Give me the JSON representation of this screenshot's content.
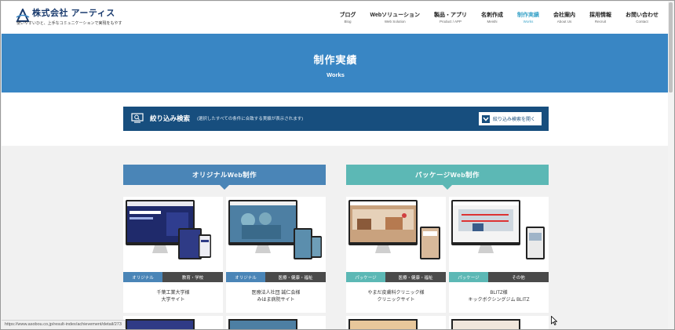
{
  "logo": {
    "name": "株式会社 アーティス",
    "tagline": "使いやすいひと、上手なコミュニケーションで実現をもやす"
  },
  "nav": [
    {
      "jp": "ブログ",
      "en": "Blog",
      "active": false
    },
    {
      "jp": "Webソリューション",
      "en": "Web Solution",
      "active": false
    },
    {
      "jp": "製品・アプリ",
      "en": "Product / APP",
      "active": false
    },
    {
      "jp": "名刺作成",
      "en": "Meishi",
      "active": false
    },
    {
      "jp": "制作実績",
      "en": "Works",
      "active": true
    },
    {
      "jp": "会社案内",
      "en": "About Us",
      "active": false
    },
    {
      "jp": "採用情報",
      "en": "Recruit",
      "active": false
    },
    {
      "jp": "お問い合わせ",
      "en": "Contact",
      "active": false
    }
  ],
  "hero": {
    "title": "制作実績",
    "subtitle": "Works"
  },
  "search": {
    "title": "絞り込み検索",
    "note": "(選択したすべての条件に合致する実績が表示されます)",
    "button": "絞り込み検索を開く"
  },
  "categories": {
    "original": "オリジナルWeb制作",
    "package": "パッケージWeb制作"
  },
  "cards": [
    {
      "tag1": "オリジナル",
      "tag2": "教育・学校",
      "line1": "千葉工業大学様",
      "line2": "大学サイト"
    },
    {
      "tag1": "オリジナル",
      "tag2": "医療・健康・福祉",
      "line1": "医療法人社団 誠仁会様",
      "line2": "みはま病院サイト"
    },
    {
      "tag1": "パッケージ",
      "tag2": "医療・健康・福祉",
      "line1": "やまだ皮膚科クリニック様",
      "line2": "クリニックサイト"
    },
    {
      "tag1": "パッケージ",
      "tag2": "その他",
      "line1": "BLITZ様",
      "line2": "キックボクシングジム BLITZ"
    }
  ],
  "status_url": "https://www.asobou.co.jp/result-index/achievement/detail/273",
  "colors": {
    "header_blue": "#3986c4",
    "search_navy": "#174e7e",
    "original_blue": "#4a85b7",
    "package_teal": "#5cb8b5",
    "active_nav": "#3aa3c8"
  }
}
